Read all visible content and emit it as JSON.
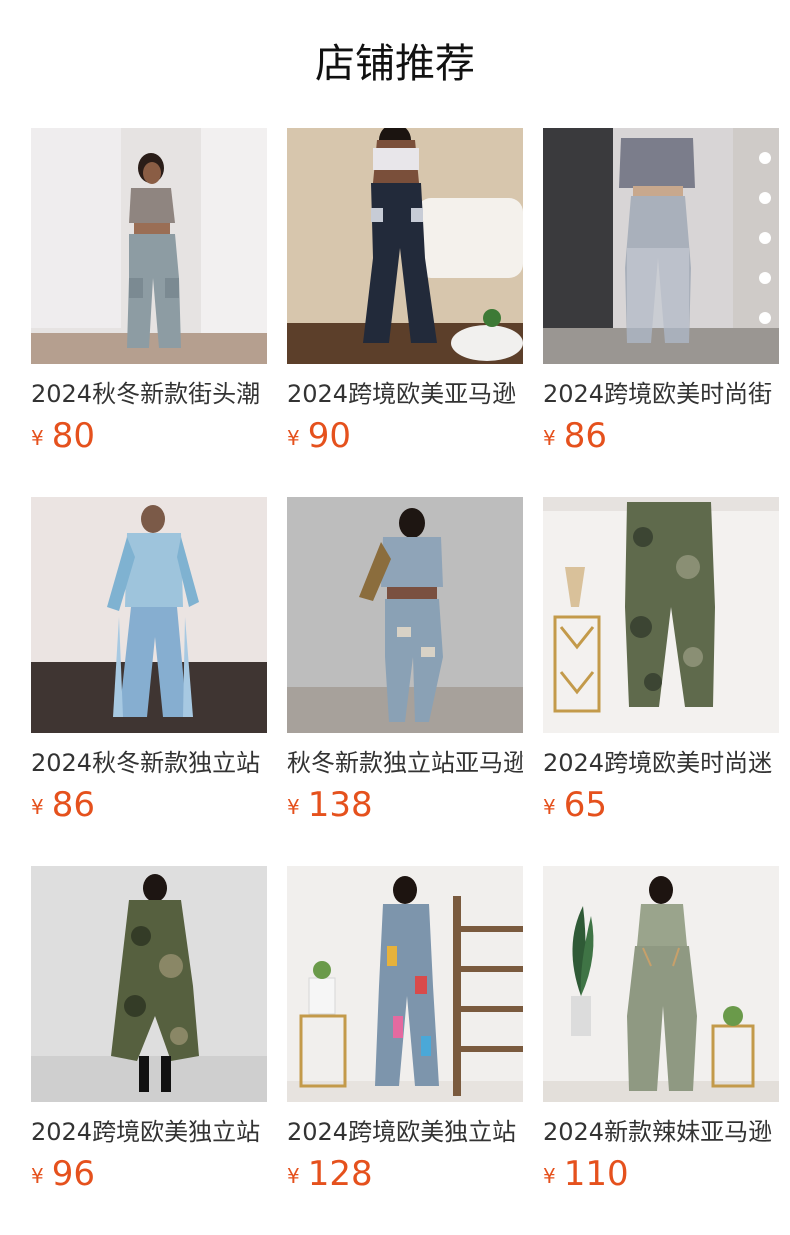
{
  "section": {
    "title": "店铺推荐"
  },
  "accent_color": "#e5511d",
  "products": [
    {
      "title": "2024秋冬新款街头潮",
      "currency": "¥",
      "price": "80",
      "image": "woman-grey-cargo-jeans"
    },
    {
      "title": "2024跨境欧美亚马逊",
      "currency": "¥",
      "price": "90",
      "image": "woman-dark-rhinestone-cargo-jeans"
    },
    {
      "title": "2024跨境欧美时尚街",
      "currency": "¥",
      "price": "86",
      "image": "woman-fringe-denim-set"
    },
    {
      "title": "2024秋冬新款独立站",
      "currency": "¥",
      "price": "86",
      "image": "woman-feather-trim-denim-set"
    },
    {
      "title": "秋冬新款独立站亚马逊",
      "currency": "¥",
      "price": "138",
      "image": "woman-distressed-denim-jacket-set"
    },
    {
      "title": "2024跨境欧美时尚迷",
      "currency": "¥",
      "price": "65",
      "image": "camouflage-cargo-pants"
    },
    {
      "title": "2024跨境欧美独立站",
      "currency": "¥",
      "price": "96",
      "image": "woman-camouflage-long-coat"
    },
    {
      "title": "2024跨境欧美独立站",
      "currency": "¥",
      "price": "128",
      "image": "woman-paint-splatter-denim-jumpsuit"
    },
    {
      "title": "2024新款辣妹亚马逊",
      "currency": "¥",
      "price": "110",
      "image": "woman-green-denim-corset-set"
    }
  ]
}
